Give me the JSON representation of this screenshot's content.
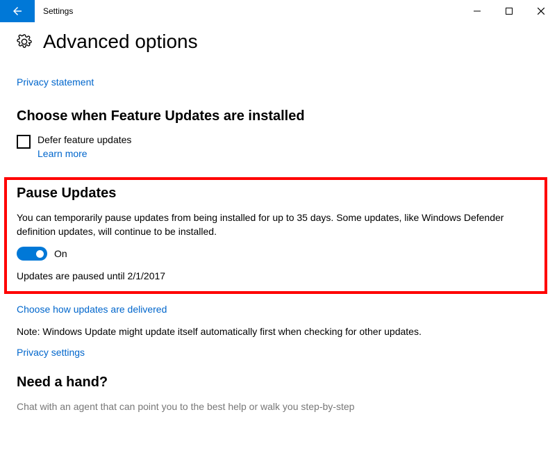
{
  "titlebar": {
    "app_name": "Settings"
  },
  "header": {
    "title": "Advanced options"
  },
  "privacy_statement_link": "Privacy statement",
  "section_feature": {
    "heading": "Choose when Feature Updates are installed",
    "checkbox_label": "Defer feature updates",
    "learn_more": "Learn more"
  },
  "section_pause": {
    "heading": "Pause Updates",
    "description": "You can temporarily pause updates from being installed for up to 35 days. Some updates, like Windows Defender definition updates, will continue to be installed.",
    "toggle_label": "On",
    "status": "Updates are paused until 2/1/2017"
  },
  "delivery_link": "Choose how updates are delivered",
  "note": "Note: Windows Update might update itself automatically first when checking for other updates.",
  "privacy_settings_link": "Privacy settings",
  "help": {
    "heading": "Need a hand?",
    "subtext": "Chat with an agent that can point you to the best help or walk you step-by-step"
  }
}
